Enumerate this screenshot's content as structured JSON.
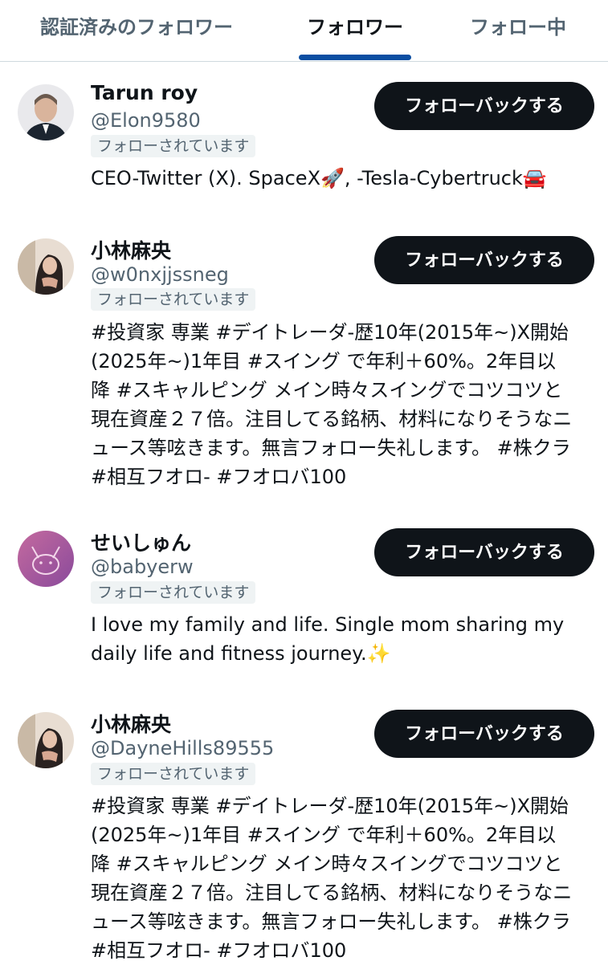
{
  "tabs": [
    {
      "label": "認証済みのフォロワー"
    },
    {
      "label": "フォロワー"
    },
    {
      "label": "フォロー中"
    }
  ],
  "follow_back_label": "フォローバックする",
  "followed_badge": "フォローされています",
  "users": [
    {
      "name": "Tarun roy",
      "handle": "@Elon9580",
      "bio_lines": [
        "CEO-Twitter (X). SpaceX🚀, -Tesla-Cybertruck🚘"
      ]
    },
    {
      "name": "小林麻央",
      "handle": "@w0nxjjssneg",
      "bio_lines": [
        "#投資家 専業 #デイトレーダ-歴10年(2015年~)X開始",
        "(2025年~)1年目 #スイング で年利＋60%。2年目以",
        "降 #スキャルピング メイン時々スイングでコツコツと",
        "現在資産２７倍。注目してる銘柄、材料になりそうなニ",
        "ュース等呟きます。無言フォロー失礼します。 #株クラ",
        "#相互フオロ- #フオロバ100"
      ]
    },
    {
      "name": "せいしゅん",
      "handle": "@babyerw",
      "bio_lines": [
        "I love my family and life. Single mom sharing my",
        "daily life and fitness journey.✨"
      ]
    },
    {
      "name": "小林麻央",
      "handle": "@DayneHills89555",
      "bio_lines": [
        "#投資家 専業 #デイトレーダ-歴10年(2015年~)X開始",
        "(2025年~)1年目 #スイング で年利＋60%。2年目以",
        "降 #スキャルピング メイン時々スイングでコツコツと",
        "現在資産２７倍。注目してる銘柄、材料になりそうなニ",
        "ュース等呟きます。無言フォロー失礼します。 #株クラ",
        "#相互フオロ- #フオロバ100"
      ]
    }
  ]
}
